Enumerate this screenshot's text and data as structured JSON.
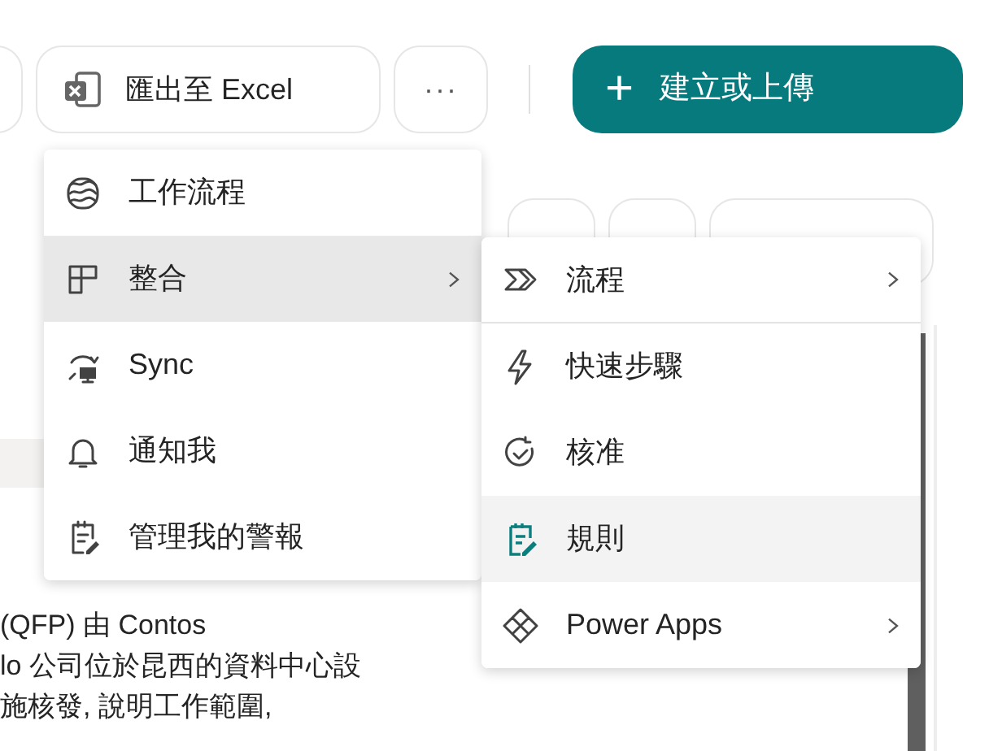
{
  "toolbar": {
    "export_button": "匯出至 Excel",
    "more_button": "···",
    "create_button": {
      "icon": "+",
      "label": "建立或上傳"
    }
  },
  "body_text": [
    "(QFP) 由 Contos",
    "lo 公司位於昆西的資料中心設",
    "施核發, 說明工作範圍,"
  ],
  "menu": {
    "items": [
      {
        "kind": "workflows",
        "label": "工作流程",
        "highlighted": false,
        "submenu": false
      },
      {
        "kind": "integrate",
        "label": "整合",
        "highlighted": true,
        "submenu": true
      },
      {
        "kind": "sync",
        "label": "Sync",
        "highlighted": false,
        "submenu": false
      },
      {
        "kind": "bell",
        "label": "通知我",
        "highlighted": false,
        "submenu": false
      },
      {
        "kind": "alerts",
        "label": "管理我的警報",
        "highlighted": false,
        "submenu": false
      }
    ]
  },
  "submenu": {
    "items": [
      {
        "kind": "flow",
        "label": "流程",
        "highlighted": false,
        "submenu": true,
        "divider_after": true
      },
      {
        "kind": "bolt",
        "label": "快速步驟",
        "highlighted": false,
        "submenu": false,
        "divider_after": false
      },
      {
        "kind": "approval",
        "label": "核准",
        "highlighted": false,
        "submenu": false,
        "divider_after": false
      },
      {
        "kind": "rules",
        "label": "規則",
        "highlighted": true,
        "submenu": false,
        "divider_after": false
      },
      {
        "kind": "apps",
        "label": "Power Apps",
        "highlighted": false,
        "submenu": true,
        "divider_after": false
      }
    ]
  }
}
